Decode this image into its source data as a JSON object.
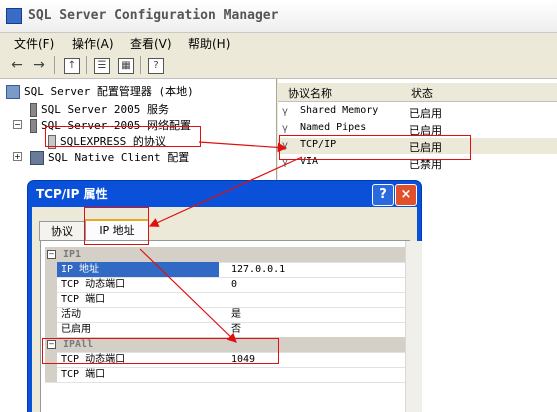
{
  "window": {
    "title": "SQL Server Configuration Manager"
  },
  "menu": {
    "file": "文件(F)",
    "action": "操作(A)",
    "view": "查看(V)",
    "help": "帮助(H)"
  },
  "toolbar": {
    "back_icon": "back-arrow-icon",
    "forward_icon": "forward-arrow-icon"
  },
  "tree": {
    "root": "SQL Server 配置管理器 (本地)",
    "items": [
      {
        "label": "SQL Server 2005 服务"
      },
      {
        "label": "SQL Server 2005 网络配置"
      },
      {
        "label": "SQLEXPRESS 的协议"
      },
      {
        "label": "SQL Native Client 配置"
      }
    ]
  },
  "list": {
    "columns": [
      "协议名称",
      "状态"
    ],
    "rows": [
      {
        "name": "Shared Memory",
        "status": "已启用"
      },
      {
        "name": "Named Pipes",
        "status": "已启用"
      },
      {
        "name": "TCP/IP",
        "status": "已启用"
      },
      {
        "name": "VIA",
        "status": "已禁用"
      }
    ]
  },
  "dialog": {
    "title": "TCP/IP 属性",
    "tabs": [
      "协议",
      "IP 地址"
    ],
    "ip1": {
      "header": "IP1",
      "rows": [
        {
          "key": "IP 地址",
          "value": "127.0.0.1"
        },
        {
          "key": "TCP 动态端口",
          "value": "0"
        },
        {
          "key": "TCP 端口",
          "value": ""
        },
        {
          "key": "活动",
          "value": "是"
        },
        {
          "key": "已启用",
          "value": "否"
        }
      ]
    },
    "ipall": {
      "header": "IPAll",
      "rows": [
        {
          "key": "TCP 动态端口",
          "value": "1049"
        },
        {
          "key": "TCP 端口",
          "value": ""
        }
      ]
    }
  }
}
